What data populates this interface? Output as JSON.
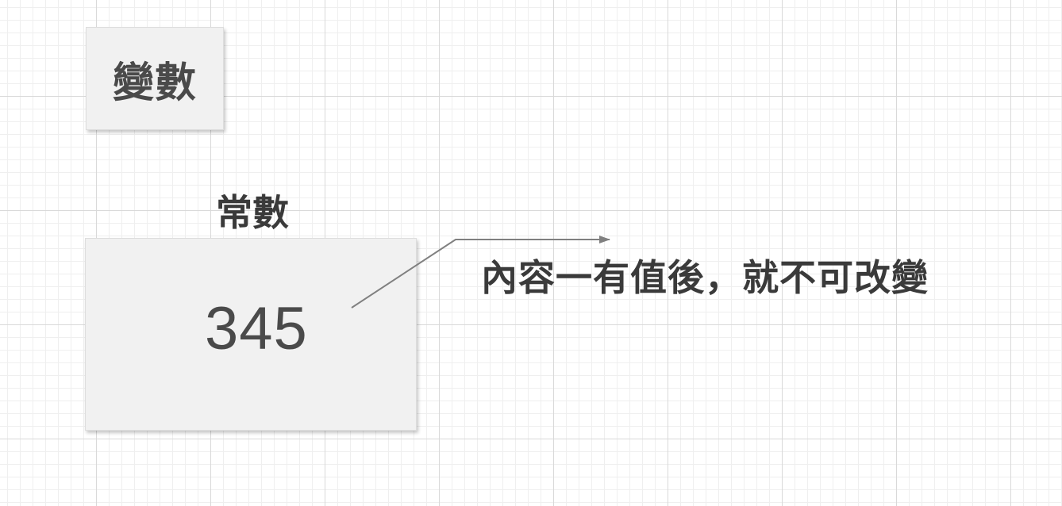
{
  "nodes": {
    "variable": {
      "label": "變數"
    },
    "constant": {
      "title": "常數",
      "value": "345"
    }
  },
  "annotation": {
    "text": "內容一有值後，就不可改變"
  },
  "colors": {
    "card_fill": "#f1f1f1",
    "text": "#4a4a4a",
    "arrow": "#808080",
    "grid_major": "#d9d9d9",
    "grid_minor": "#efefef"
  }
}
